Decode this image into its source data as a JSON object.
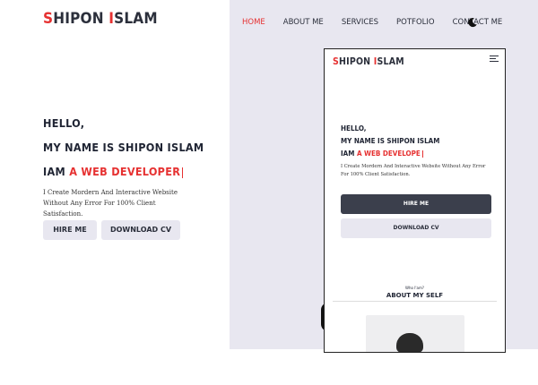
{
  "brand": {
    "first_cap": "S",
    "first_rest": "HIPON",
    "second_cap": "I",
    "second_rest": "SLAM"
  },
  "nav": {
    "home": "HOME",
    "about": "ABOUT ME",
    "services": "SERVICES",
    "portfolio": "POTFOLIO",
    "contact": "CONTACT ME"
  },
  "hero": {
    "hello": "HELLO,",
    "name_line": "MY NAME IS SHIPON ISLAM",
    "iam": "IAM",
    "role": "A WEB DEVELOPER",
    "description": "I Create Mordern And Interactive Website Without Any Error For 100% Client Satisfaction.",
    "hire_label": "HIRE ME",
    "cv_label": "DOWNLOAD CV"
  },
  "mobile": {
    "role": "A WEB DEVELOPE",
    "who_am": "Who I'am?",
    "about_heading": "ABOUT MY SELF"
  },
  "colors": {
    "accent": "#e63131",
    "panel": "#e8e7f0",
    "dark_button": "#3b3f4c"
  },
  "icons": {
    "theme_toggle": "moon-icon",
    "mobile_menu": "hamburger-menu-icon"
  }
}
